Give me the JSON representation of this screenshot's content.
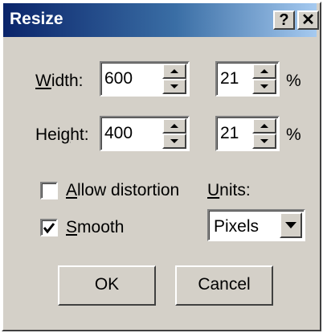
{
  "window": {
    "title": "Resize",
    "help_button": "?",
    "close_button": "✕"
  },
  "size": {
    "width": {
      "label_prefix": "",
      "label_accel": "W",
      "label_rest": "idth:",
      "value": "600",
      "percent_value": "21",
      "percent_symbol": "%"
    },
    "height": {
      "label_prefix": "Hei",
      "label_accel": "g",
      "label_rest": "ht:",
      "value": "400",
      "percent_value": "21",
      "percent_symbol": "%"
    }
  },
  "options": {
    "allow_distortion": {
      "accel": "A",
      "rest": "llow distortion",
      "checked": false
    },
    "smooth": {
      "accel": "S",
      "rest": "mooth",
      "checked": true
    }
  },
  "units": {
    "label_accel": "U",
    "label_rest": "nits:",
    "selected": "Pixels"
  },
  "buttons": {
    "ok": "OK",
    "cancel": "Cancel"
  },
  "icons": {
    "spin_up": "triangle-up-icon",
    "spin_down": "triangle-down-icon",
    "dropdown": "triangle-down-icon",
    "check": "checkmark-icon"
  }
}
